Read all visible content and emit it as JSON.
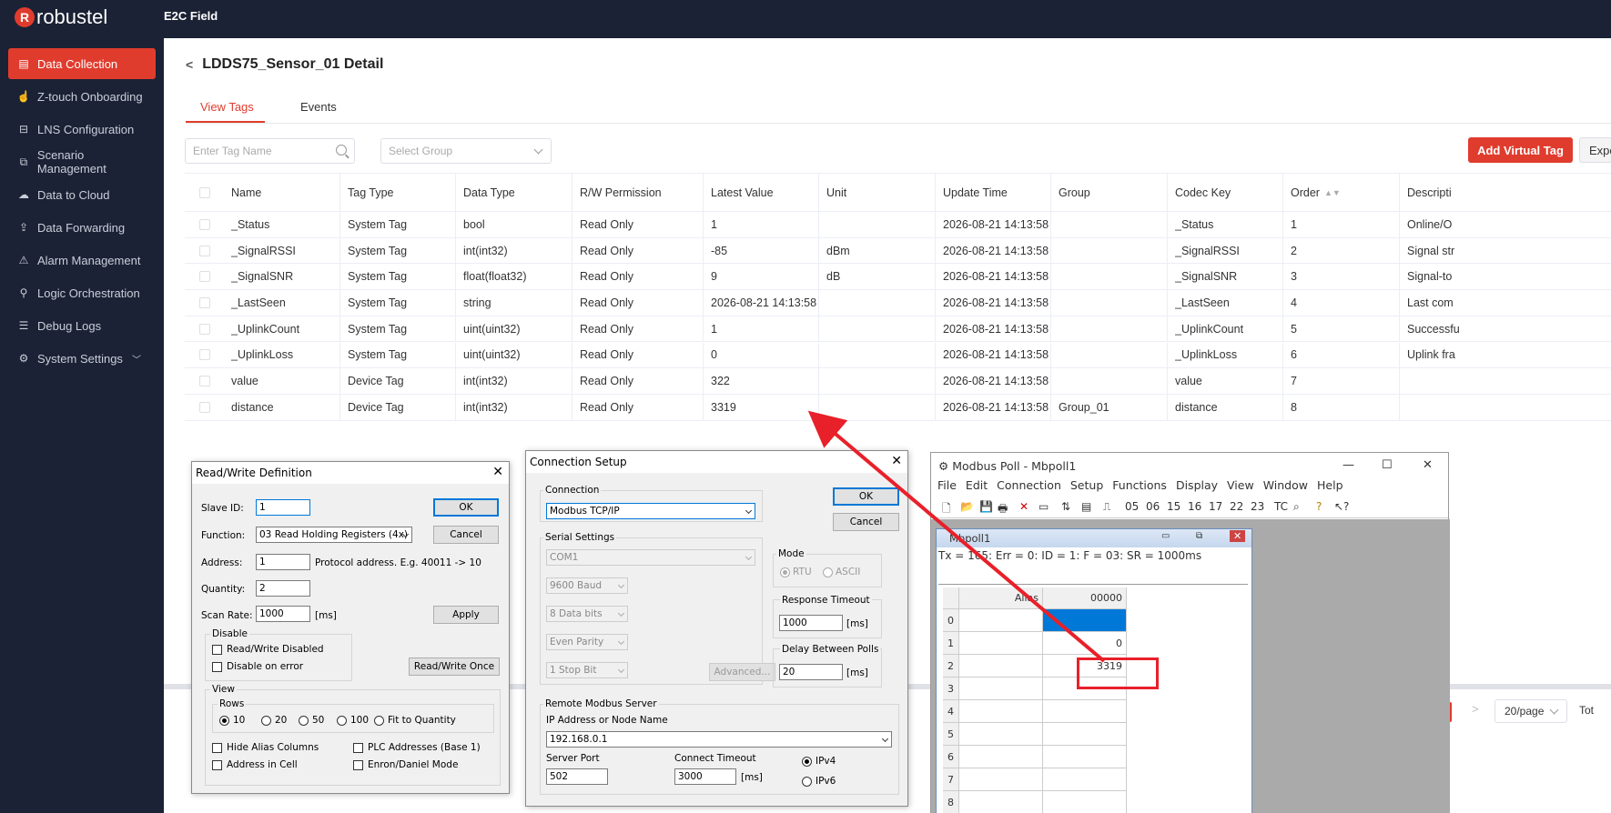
{
  "brand": {
    "logo": "robustel",
    "product": "E2C Field"
  },
  "sidebar": {
    "items": [
      {
        "label": "Data Collection",
        "icon": "data-collection-icon",
        "active": true
      },
      {
        "label": "Z-touch Onboarding",
        "icon": "touch-icon"
      },
      {
        "label": "LNS Configuration",
        "icon": "lns-icon"
      },
      {
        "label": "Scenario Management",
        "icon": "scenario-icon"
      },
      {
        "label": "Data to Cloud",
        "icon": "cloud-icon"
      },
      {
        "label": "Data Forwarding",
        "icon": "forward-icon"
      },
      {
        "label": "Alarm Management",
        "icon": "alarm-icon"
      },
      {
        "label": "Logic Orchestration",
        "icon": "logic-icon"
      },
      {
        "label": "Debug Logs",
        "icon": "log-icon"
      },
      {
        "label": "System Settings",
        "icon": "gear-icon"
      }
    ]
  },
  "page": {
    "title": "LDDS75_Sensor_01 Detail",
    "tabs": [
      "View Tags",
      "Events"
    ],
    "search_placeholder": "Enter Tag Name",
    "group_placeholder": "Select Group",
    "add_button": "Add Virtual Tag",
    "export_button": "Expo"
  },
  "table": {
    "headers": [
      "Name",
      "Tag Type",
      "Data Type",
      "R/W Permission",
      "Latest Value",
      "Unit",
      "Update Time",
      "Group",
      "Codec Key",
      "Order",
      "Descripti"
    ],
    "rows": [
      [
        "_Status",
        "System Tag",
        "bool",
        "Read Only",
        "1",
        "",
        "2026-08-21 14:13:58",
        "",
        "_Status",
        "1",
        "Online/O"
      ],
      [
        "_SignalRSSI",
        "System Tag",
        "int(int32)",
        "Read Only",
        "-85",
        "dBm",
        "2026-08-21 14:13:58",
        "",
        "_SignalRSSI",
        "2",
        "Signal str"
      ],
      [
        "_SignalSNR",
        "System Tag",
        "float(float32)",
        "Read Only",
        "9",
        "dB",
        "2026-08-21 14:13:58",
        "",
        "_SignalSNR",
        "3",
        "Signal-to"
      ],
      [
        "_LastSeen",
        "System Tag",
        "string",
        "Read Only",
        "2026-08-21 14:13:58",
        "",
        "2026-08-21 14:13:58",
        "",
        "_LastSeen",
        "4",
        "Last com"
      ],
      [
        "_UplinkCount",
        "System Tag",
        "uint(uint32)",
        "Read Only",
        "1",
        "",
        "2026-08-21 14:13:58",
        "",
        "_UplinkCount",
        "5",
        "Successfu"
      ],
      [
        "_UplinkLoss",
        "System Tag",
        "uint(uint32)",
        "Read Only",
        "0",
        "",
        "2026-08-21 14:13:58",
        "",
        "_UplinkLoss",
        "6",
        "Uplink fra"
      ],
      [
        "value",
        "Device Tag",
        "int(int32)",
        "Read Only",
        "322",
        "",
        "2026-08-21 14:13:58",
        "",
        "value",
        "7",
        ""
      ],
      [
        "distance",
        "Device Tag",
        "int(int32)",
        "Read Only",
        "3319",
        "",
        "2026-08-21 14:13:58",
        "Group_01",
        "distance",
        "8",
        ""
      ]
    ]
  },
  "pager": {
    "size": "20/page",
    "total": "Tot"
  },
  "rw_dialog": {
    "title": "Read/Write Definition",
    "slave_id_label": "Slave ID:",
    "slave_id": "1",
    "function_label": "Function:",
    "function": "03 Read Holding Registers (4x)",
    "address_label": "Address:",
    "address": "1",
    "address_hint": "Protocol address. E.g. 40011 -> 10",
    "quantity_label": "Quantity:",
    "quantity": "2",
    "scan_label": "Scan Rate:",
    "scan": "1000",
    "scan_unit": "[ms]",
    "ok": "OK",
    "cancel": "Cancel",
    "apply": "Apply",
    "rw_once": "Read/Write Once",
    "disable_label": "Disable",
    "rw_disabled": "Read/Write Disabled",
    "disable_err": "Disable on error",
    "view_label": "View",
    "rows_label": "Rows",
    "rows_opts": [
      "10",
      "20",
      "50",
      "100",
      "Fit to Quantity"
    ],
    "hide_alias": "Hide Alias Columns",
    "plc_addr": "PLC Addresses (Base 1)",
    "addr_cell": "Address in Cell",
    "enron": "Enron/Daniel Mode"
  },
  "conn_dialog": {
    "title": "Connection Setup",
    "conn_label": "Connection",
    "conn_value": "Modbus TCP/IP",
    "ok": "OK",
    "cancel": "Cancel",
    "serial_label": "Serial Settings",
    "com": "COM1",
    "baud": "9600 Baud",
    "bits": "8 Data bits",
    "parity": "Even Parity",
    "stop": "1 Stop Bit",
    "advanced": "Advanced...",
    "mode_label": "Mode",
    "rtu": "RTU",
    "ascii": "ASCII",
    "resp_label": "Response Timeout",
    "resp": "1000",
    "resp_unit": "[ms]",
    "delay_label": "Delay Between Polls",
    "delay": "20",
    "delay_unit": "[ms]",
    "remote_label": "Remote Modbus Server",
    "ip_label": "IP Address or Node Name",
    "ip": "192.168.0.1",
    "port_label": "Server Port",
    "port": "502",
    "ct_label": "Connect Timeout",
    "ct": "3000",
    "ct_unit": "[ms]",
    "ipv4": "IPv4",
    "ipv6": "IPv6"
  },
  "mbpoll": {
    "title": "Modbus Poll - Mbpoll1",
    "menu": [
      "File",
      "Edit",
      "Connection",
      "Setup",
      "Functions",
      "Display",
      "View",
      "Window",
      "Help"
    ],
    "toolbar_codes": [
      "05",
      "06",
      "15",
      "16",
      "17",
      "22",
      "23",
      "TC"
    ],
    "child_title": "Mbpoll1",
    "status": "Tx = 165: Err = 0: ID = 1: F = 03: SR = 1000ms",
    "col_alias": "Alias",
    "col_addr": "00000",
    "row_ids": [
      "0",
      "1",
      "2",
      "3",
      "4",
      "5",
      "6",
      "7",
      "8"
    ],
    "values": [
      "",
      "0",
      "3319",
      "",
      "",
      "",
      "",
      "",
      ""
    ]
  },
  "colors": {
    "accent": "#e03c2e",
    "nav": "#1b2235",
    "annot": "#e8202a"
  }
}
